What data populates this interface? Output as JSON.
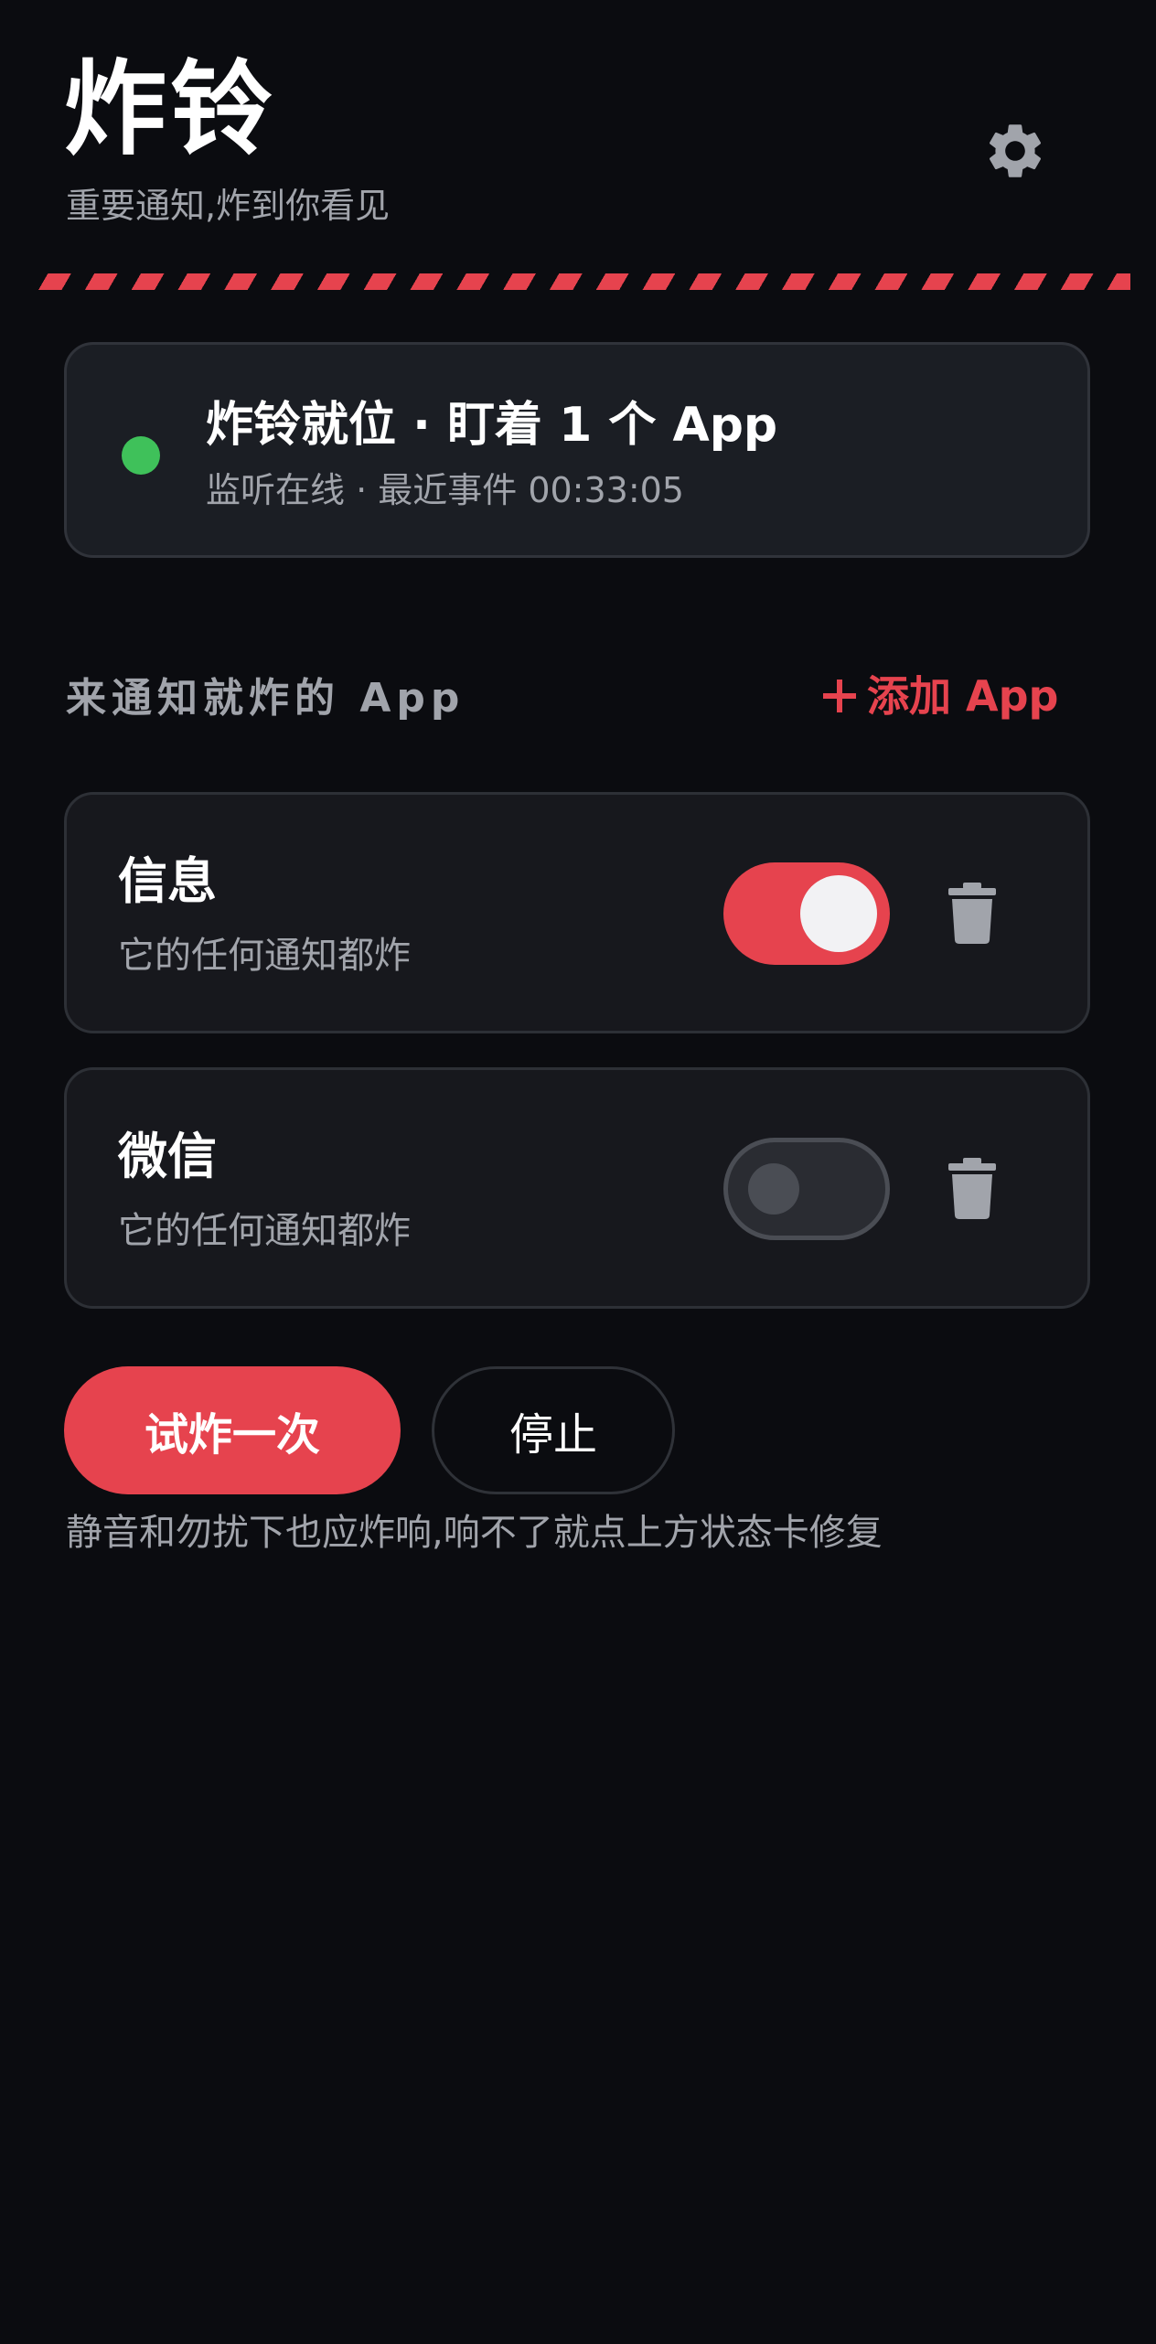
{
  "header": {
    "title": "炸铃",
    "subtitle": "重要通知,炸到你看见",
    "settings_icon": "gear-icon"
  },
  "status": {
    "title": "炸铃就位 · 盯着 1 个 App",
    "subtitle": "监听在线 · 最近事件 00:33:05",
    "state": "online",
    "dot_color": "#3fc15a"
  },
  "apps_section": {
    "label": "来通知就炸的 App",
    "add_button": "添加 App"
  },
  "apps": [
    {
      "name": "信息",
      "description": "它的任何通知都炸",
      "enabled": true
    },
    {
      "name": "微信",
      "description": "它的任何通知都炸",
      "enabled": false
    }
  ],
  "actions": {
    "test_button": "试炸一次",
    "stop_button": "停止",
    "hint": "静音和勿扰下也应炸响,响不了就点上方状态卡修复"
  },
  "colors": {
    "accent": "#e6434e",
    "background": "#0b0c10",
    "card": "#1b1e24",
    "muted_text": "#a1a4ab"
  }
}
